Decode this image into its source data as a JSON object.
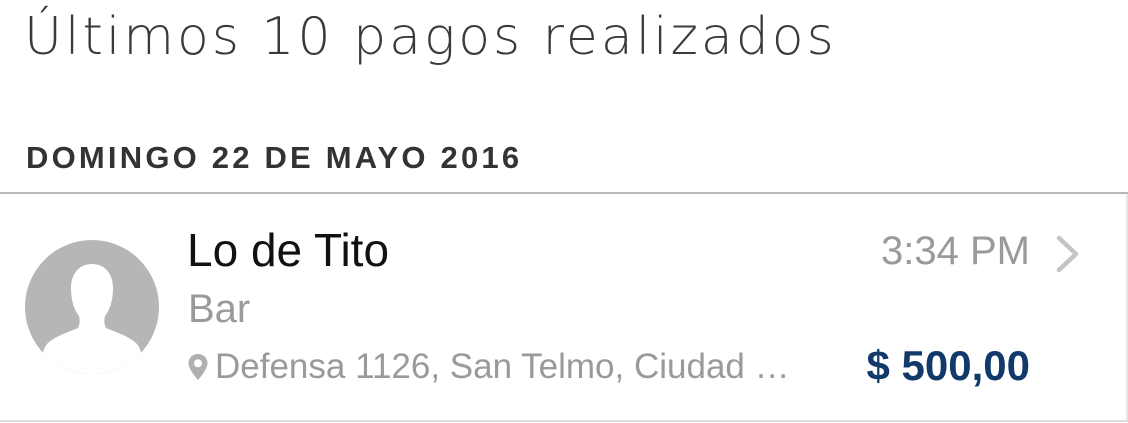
{
  "page": {
    "title": "Últimos 10 pagos realizados"
  },
  "section": {
    "date_header": "DOMINGO 22 DE MAYO 2016"
  },
  "payments": [
    {
      "merchant": "Lo de Tito",
      "category": "Bar",
      "address": "Defensa 1126, San Telmo, Ciudad …",
      "time": "3:34 PM",
      "amount": "$ 500,00",
      "avatar_icon": "user-silhouette-icon",
      "location_icon": "map-pin-icon",
      "action_icon": "chevron-right-icon"
    }
  ],
  "colors": {
    "amount": "#11396a",
    "secondary_text": "#9a9a9a",
    "avatar_bg": "#b6b6b6"
  }
}
